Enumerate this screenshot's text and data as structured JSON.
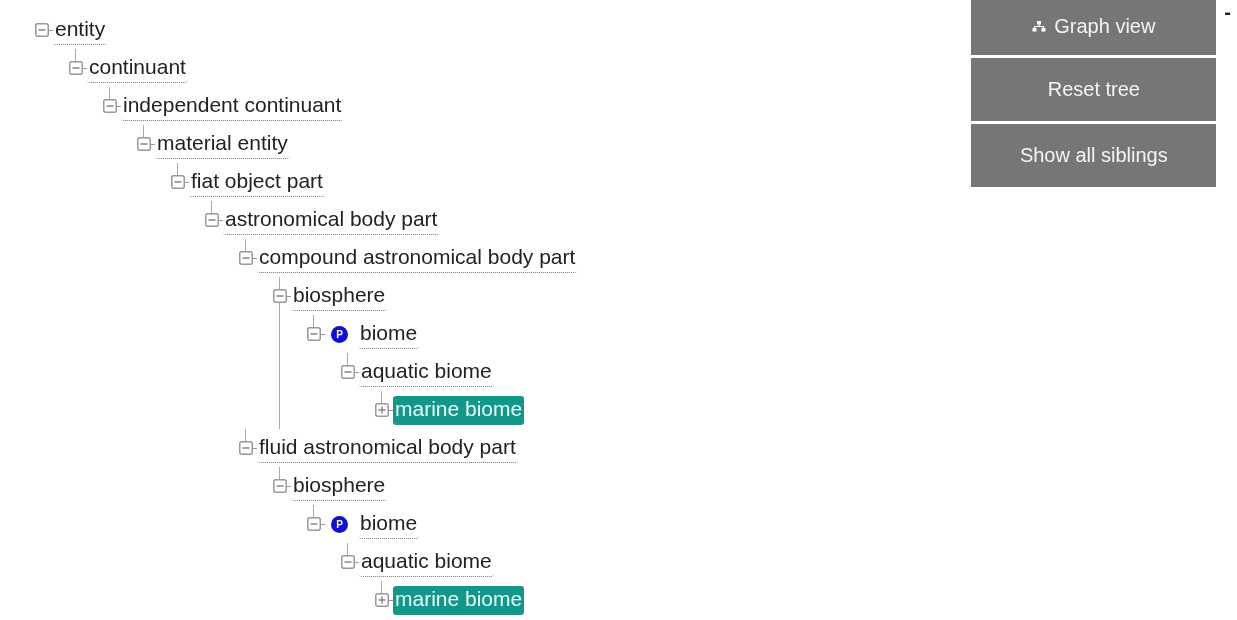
{
  "tree": [
    {
      "label": "entity",
      "expanded": true,
      "selected": false,
      "children": [
        {
          "label": "continuant",
          "expanded": true,
          "selected": false,
          "children": [
            {
              "label": "independent continuant",
              "expanded": true,
              "selected": false,
              "children": [
                {
                  "label": "material entity",
                  "expanded": true,
                  "selected": false,
                  "children": [
                    {
                      "label": "fiat object part",
                      "expanded": true,
                      "selected": false,
                      "children": [
                        {
                          "label": "astronomical body part",
                          "expanded": true,
                          "selected": false,
                          "children": [
                            {
                              "label": "compound astronomical body part",
                              "expanded": true,
                              "selected": false,
                              "children": [
                                {
                                  "label": "biosphere",
                                  "expanded": true,
                                  "selected": false,
                                  "children": [
                                    {
                                      "label": "biome",
                                      "badge": "P",
                                      "expanded": true,
                                      "selected": false,
                                      "children": [
                                        {
                                          "label": "aquatic biome",
                                          "expanded": true,
                                          "selected": false,
                                          "children": [
                                            {
                                              "label": "marine biome",
                                              "expanded": false,
                                              "selected": true
                                            }
                                          ]
                                        }
                                      ]
                                    }
                                  ]
                                }
                              ]
                            },
                            {
                              "label": "fluid astronomical body part",
                              "expanded": true,
                              "selected": false,
                              "children": [
                                {
                                  "label": "biosphere",
                                  "expanded": true,
                                  "selected": false,
                                  "children": [
                                    {
                                      "label": "biome",
                                      "badge": "P",
                                      "expanded": true,
                                      "selected": false,
                                      "children": [
                                        {
                                          "label": "aquatic biome",
                                          "expanded": true,
                                          "selected": false,
                                          "children": [
                                            {
                                              "label": "marine biome",
                                              "expanded": false,
                                              "selected": true
                                            }
                                          ]
                                        }
                                      ]
                                    }
                                  ]
                                }
                              ]
                            }
                          ]
                        }
                      ]
                    }
                  ]
                }
              ]
            }
          ]
        }
      ]
    }
  ],
  "buttons": [
    {
      "kind": "graph",
      "label": "Graph view"
    },
    {
      "kind": "plain",
      "label": "Reset tree"
    },
    {
      "kind": "plain",
      "label": "Show all siblings"
    }
  ],
  "collapse_mark": "-"
}
